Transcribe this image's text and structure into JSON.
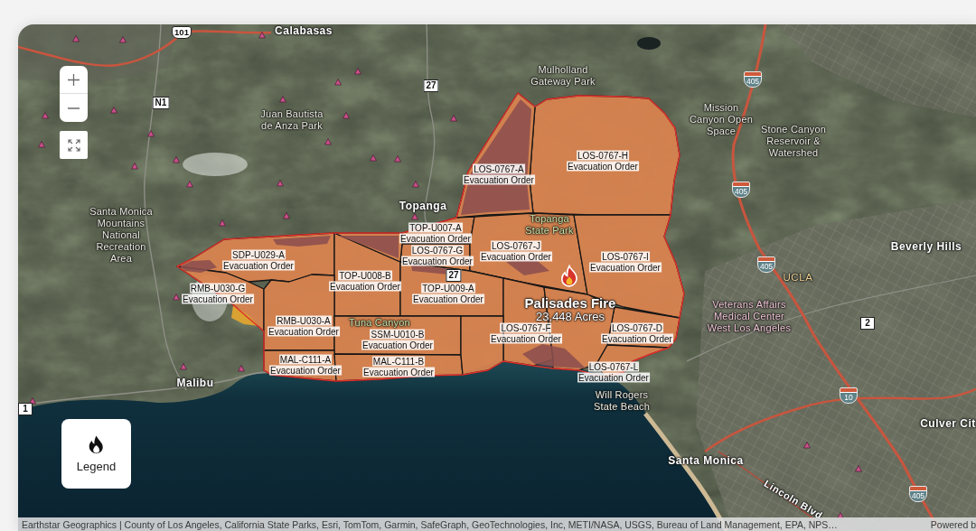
{
  "map_controls": [
    {
      "kind": "zoom_in"
    },
    {
      "kind": "zoom_out"
    },
    {
      "kind": "fullscreen"
    }
  ],
  "map": {
    "place_labels": [
      {
        "text": "Calabasas",
        "kind": "city"
      },
      {
        "text": "Mulholland Gateway Park",
        "kind": "area"
      },
      {
        "text": "Juan Bautista de Anza Park",
        "kind": "area"
      },
      {
        "text": "Mission Canyon Open Space",
        "kind": "area"
      },
      {
        "text": "Stone Canyon Reservoir & Watershed",
        "kind": "area"
      },
      {
        "text": "Topanga",
        "kind": "city"
      },
      {
        "text": "Santa Monica Mountains National Recreation Area",
        "kind": "area"
      },
      {
        "text": "Topanga State Park",
        "kind": "park"
      },
      {
        "text": "Beverly Hills",
        "kind": "city"
      },
      {
        "text": "UCLA",
        "kind": "campus"
      },
      {
        "text": "Tuna Canyon",
        "kind": "park"
      },
      {
        "text": "Veterans Affairs Medical Center West Los Angeles",
        "kind": "medical"
      },
      {
        "text": "Malibu",
        "kind": "city"
      },
      {
        "text": "Will Rogers State Beach",
        "kind": "area"
      },
      {
        "text": "Culver Cit",
        "kind": "city"
      },
      {
        "text": "Santa Monica",
        "kind": "city"
      },
      {
        "text": "Lincoln Blvd",
        "kind": "street"
      }
    ],
    "route_signs": [
      {
        "text": "101",
        "kind": "us"
      },
      {
        "text": "N1",
        "kind": "state"
      },
      {
        "text": "27",
        "kind": "state"
      },
      {
        "text": "405",
        "kind": "interstate"
      },
      {
        "text": "405",
        "kind": "interstate"
      },
      {
        "text": "27",
        "kind": "state"
      },
      {
        "text": "405",
        "kind": "interstate"
      },
      {
        "text": "2",
        "kind": "state"
      },
      {
        "text": "10",
        "kind": "interstate"
      },
      {
        "text": "1",
        "kind": "state"
      },
      {
        "text": "405",
        "kind": "interstate"
      }
    ],
    "fire": {
      "name": "Palisades Fire",
      "area": "23,448 Acres"
    },
    "evacuation_zones": [
      {
        "zone": "LOS-0767-H",
        "status": "Evacuation Order"
      },
      {
        "zone": "LOS-0767-A",
        "status": "Evacuation Order"
      },
      {
        "zone": "TOP-U007-A",
        "status": "Evacuation Order"
      },
      {
        "zone": "SDP-U029-A",
        "status": "Evacuation Order"
      },
      {
        "zone": "LOS-0767-G",
        "status": "Evacuation Order"
      },
      {
        "zone": "LOS-0767-J",
        "status": "Evacuation Order"
      },
      {
        "zone": "LOS-0767-I",
        "status": "Evacuation Order"
      },
      {
        "zone": "RMB-U030-G",
        "status": "Evacuation Order"
      },
      {
        "zone": "TOP-U008-B",
        "status": "Evacuation Order"
      },
      {
        "zone": "TOP-U009-A",
        "status": "Evacuation Order"
      },
      {
        "zone": "RMB-U030-A",
        "status": "Evacuation Order"
      },
      {
        "zone": "SSM-U010-B",
        "status": "Evacuation Order"
      },
      {
        "zone": "LOS-0767-F",
        "status": "Evacuation Order"
      },
      {
        "zone": "LOS-0767-D",
        "status": "Evacuation Order"
      },
      {
        "zone": "MAL-C111-A",
        "status": "Evacuation Order"
      },
      {
        "zone": "MAL-C111-B",
        "status": "Evacuation Order"
      },
      {
        "zone": "LOS-0767-L",
        "status": "Evacuation Order"
      }
    ]
  },
  "legend_button": {
    "label": "Legend"
  },
  "attribution": {
    "sources": "Earthstar Geographics | County of Los Angeles, California State Parks, Esri, TomTom, Garmin, SafeGraph, GeoTechnologies, Inc, METI/NASA, USGS, Bureau of Land Management, EPA, NPS…",
    "powered_by": "Powered b"
  }
}
